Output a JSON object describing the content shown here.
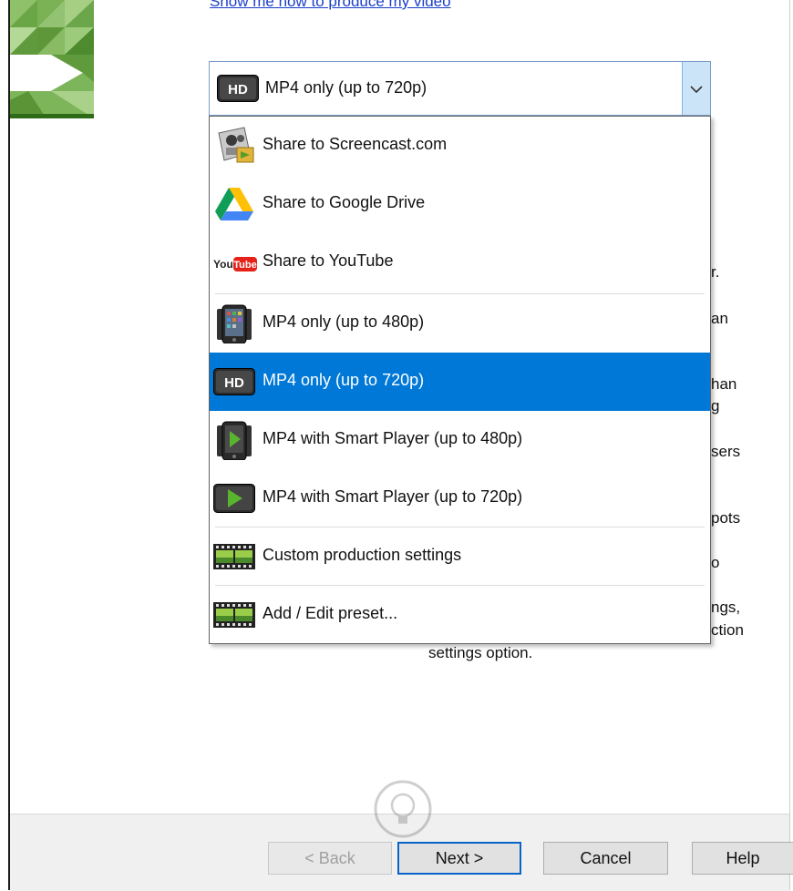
{
  "header": {
    "link_text": "Show me how to produce my video"
  },
  "combo": {
    "selected": "MP4 only (up to 720p)"
  },
  "dropdown": {
    "items": [
      {
        "label": "Share to Screencast.com",
        "icon": "screencast-icon"
      },
      {
        "label": "Share to Google Drive",
        "icon": "google-drive-icon"
      },
      {
        "label": "Share to YouTube",
        "icon": "youtube-icon",
        "icon_text": "You Tube"
      },
      {
        "label": "MP4 only (up to 480p)",
        "icon": "phone-icon"
      },
      {
        "label": "MP4 only (up to 720p)",
        "icon": "hd-icon",
        "icon_text": "HD",
        "selected": true
      },
      {
        "label": "MP4 with Smart Player (up to 480p)",
        "icon": "smart-player-phone-icon"
      },
      {
        "label": "MP4 with Smart Player (up to 720p)",
        "icon": "smart-player-icon"
      },
      {
        "label": "Custom production settings",
        "icon": "film-strip-icon"
      },
      {
        "label": "Add / Edit preset...",
        "icon": "film-strip-icon"
      }
    ]
  },
  "background_text": {
    "frag1": "r.",
    "frag2": "an",
    "frag3": "han",
    "frag4": "g",
    "frag5": "sers",
    "frag6": "pots",
    "frag7": "o",
    "frag8": "ngs,",
    "frag9": "ction",
    "settings_option": "settings option."
  },
  "footer": {
    "back": "< Back",
    "next": "Next >",
    "cancel": "Cancel",
    "help": "Help"
  },
  "colors": {
    "selection": "#0078d7",
    "link": "#1a3fc8",
    "combo_arrow_bg": "#cce4f7"
  }
}
